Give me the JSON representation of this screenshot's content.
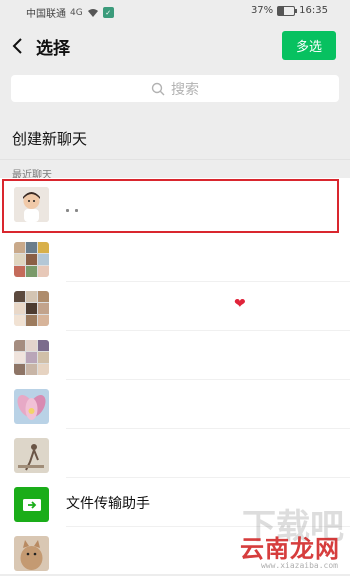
{
  "status_bar": {
    "carrier": "中国联通",
    "signal": "4G",
    "battery_pct_text": "37%",
    "battery_level": 0.37,
    "time": "16:35"
  },
  "header": {
    "title": "选择",
    "multi_select_label": "多选"
  },
  "search": {
    "placeholder": "搜索"
  },
  "new_chat_label": "创建新聊天",
  "section_label": "最近聊天",
  "chats": [
    {
      "name": "",
      "avatar": "photo-child"
    },
    {
      "name": "",
      "avatar": "group-grid"
    },
    {
      "name": "",
      "avatar": "group-grid",
      "suffix_icon": "heart"
    },
    {
      "name": "",
      "avatar": "group-grid"
    },
    {
      "name": "",
      "avatar": "photo-flower"
    },
    {
      "name": "",
      "avatar": "photo-figure"
    },
    {
      "name": "文件传输助手",
      "avatar": "file-transfer-icon"
    },
    {
      "name": "",
      "avatar": "photo-cat"
    }
  ],
  "watermark": {
    "text": "云南龙网",
    "bg_text": "下载吧",
    "url": "www.xiazaiba.com"
  },
  "colors": {
    "accent": "#07c160",
    "selection_border": "#d9262e"
  }
}
